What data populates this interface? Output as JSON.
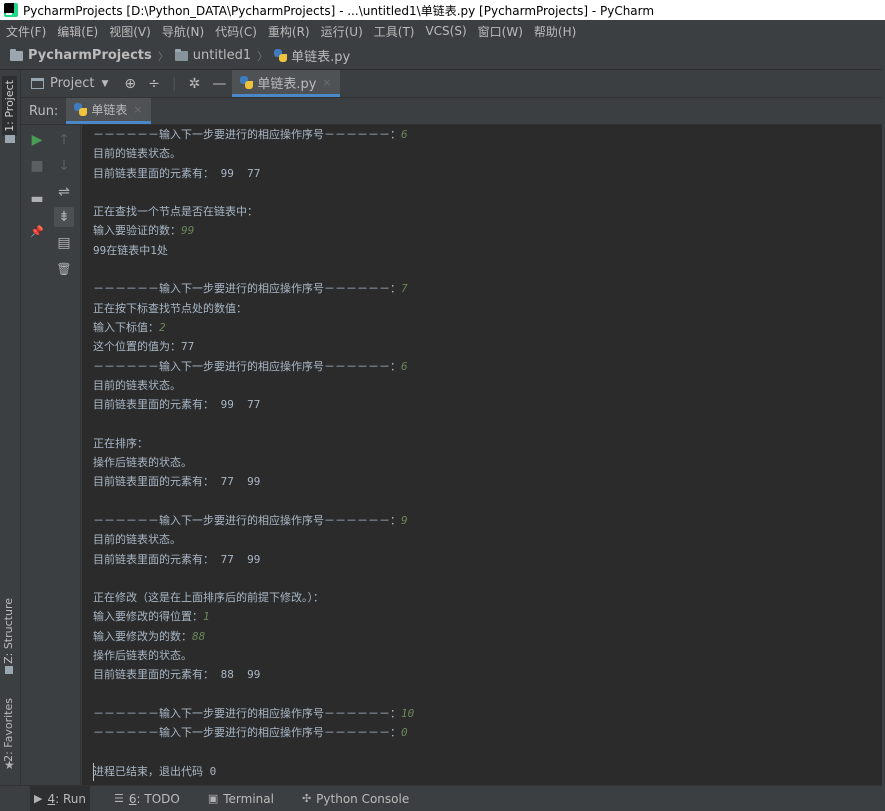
{
  "window": {
    "title": "PycharmProjects [D:\\Python_DATA\\PycharmProjects] - ...\\untitled1\\单链表.py [PycharmProjects] - PyCharm"
  },
  "menu": {
    "items": [
      "文件(F)",
      "编辑(E)",
      "视图(V)",
      "导航(N)",
      "代码(C)",
      "重构(R)",
      "运行(U)",
      "工具(T)",
      "VCS(S)",
      "窗口(W)",
      "帮助(H)"
    ]
  },
  "breadcrumb": {
    "project": "PycharmProjects",
    "folder": "untitled1",
    "file": "单链表.py"
  },
  "left_strip": {
    "project_tab": "1: Project",
    "structure_tab": "Z: Structure",
    "favorites_tab": "2: Favorites"
  },
  "project_toolbar": {
    "dropdown_label": "Project",
    "dropdown_arrow": "▼",
    "target_glyph": "⊕",
    "collapse_glyph": "÷",
    "settings_glyph": "✲",
    "minimize_glyph": "—",
    "editor_tab": "单链表.py",
    "editor_tab_close": "×"
  },
  "run": {
    "label": "Run:",
    "tab": "单链表",
    "tab_close": "×"
  },
  "run_tools": {
    "rerun": "▶",
    "up": "↑",
    "stop": "■",
    "down": "↓",
    "soft_wrap": "⇌",
    "layout": "▬",
    "scroll_end": "⇟",
    "pin": "📌",
    "print": "▤",
    "delete": "🗑"
  },
  "console": {
    "lines": [
      {
        "text": "－－－－－－输入下一步要进行的相应操作序号－－－－－－：",
        "input": "6"
      },
      {
        "text": "目前的链表状态。",
        "input": ""
      },
      {
        "text": "目前链表里面的元素有： 99  77",
        "input": ""
      },
      {
        "text": "",
        "input": ""
      },
      {
        "text": "正在查找一个节点是否在链表中：",
        "input": ""
      },
      {
        "text": "输入要验证的数：",
        "input": "99"
      },
      {
        "text": "99在链表中1处",
        "input": ""
      },
      {
        "text": "",
        "input": ""
      },
      {
        "text": "－－－－－－输入下一步要进行的相应操作序号－－－－－－：",
        "input": "7"
      },
      {
        "text": "正在按下标查找节点处的数值：",
        "input": ""
      },
      {
        "text": "输入下标值：",
        "input": "2"
      },
      {
        "text": "这个位置的值为：77",
        "input": ""
      },
      {
        "text": "－－－－－－输入下一步要进行的相应操作序号－－－－－－：",
        "input": "6"
      },
      {
        "text": "目前的链表状态。",
        "input": ""
      },
      {
        "text": "目前链表里面的元素有： 99  77",
        "input": ""
      },
      {
        "text": "",
        "input": ""
      },
      {
        "text": "正在排序：",
        "input": ""
      },
      {
        "text": "操作后链表的状态。",
        "input": ""
      },
      {
        "text": "目前链表里面的元素有： 77  99",
        "input": ""
      },
      {
        "text": "",
        "input": ""
      },
      {
        "text": "－－－－－－输入下一步要进行的相应操作序号－－－－－－：",
        "input": "9"
      },
      {
        "text": "目前的链表状态。",
        "input": ""
      },
      {
        "text": "目前链表里面的元素有： 77  99",
        "input": ""
      },
      {
        "text": "",
        "input": ""
      },
      {
        "text": "正在修改（这是在上面排序后的前提下修改。）：",
        "input": ""
      },
      {
        "text": "输入要修改的得位置：",
        "input": "1"
      },
      {
        "text": "输入要修改为的数：",
        "input": "88"
      },
      {
        "text": "操作后链表的状态。",
        "input": ""
      },
      {
        "text": "目前链表里面的元素有： 88  99",
        "input": ""
      },
      {
        "text": "",
        "input": ""
      },
      {
        "text": "－－－－－－输入下一步要进行的相应操作序号－－－－－－：",
        "input": "10"
      },
      {
        "text": "－－－－－－输入下一步要进行的相应操作序号－－－－－－：",
        "input": "0"
      },
      {
        "text": "",
        "input": ""
      },
      {
        "text": "进程已结束，退出代码 0",
        "input": ""
      }
    ]
  },
  "bottom_bar": {
    "run": {
      "num": "4",
      "label": ": Run"
    },
    "todo": {
      "num": "6",
      "label": ": TODO"
    },
    "terminal": "Terminal",
    "python_console": "Python Console"
  },
  "colors": {
    "console_bg": "#2b2b2b",
    "console_text": "#a9b7c6",
    "user_input": "#6a8759",
    "tab_underline": "#4a88c7"
  }
}
